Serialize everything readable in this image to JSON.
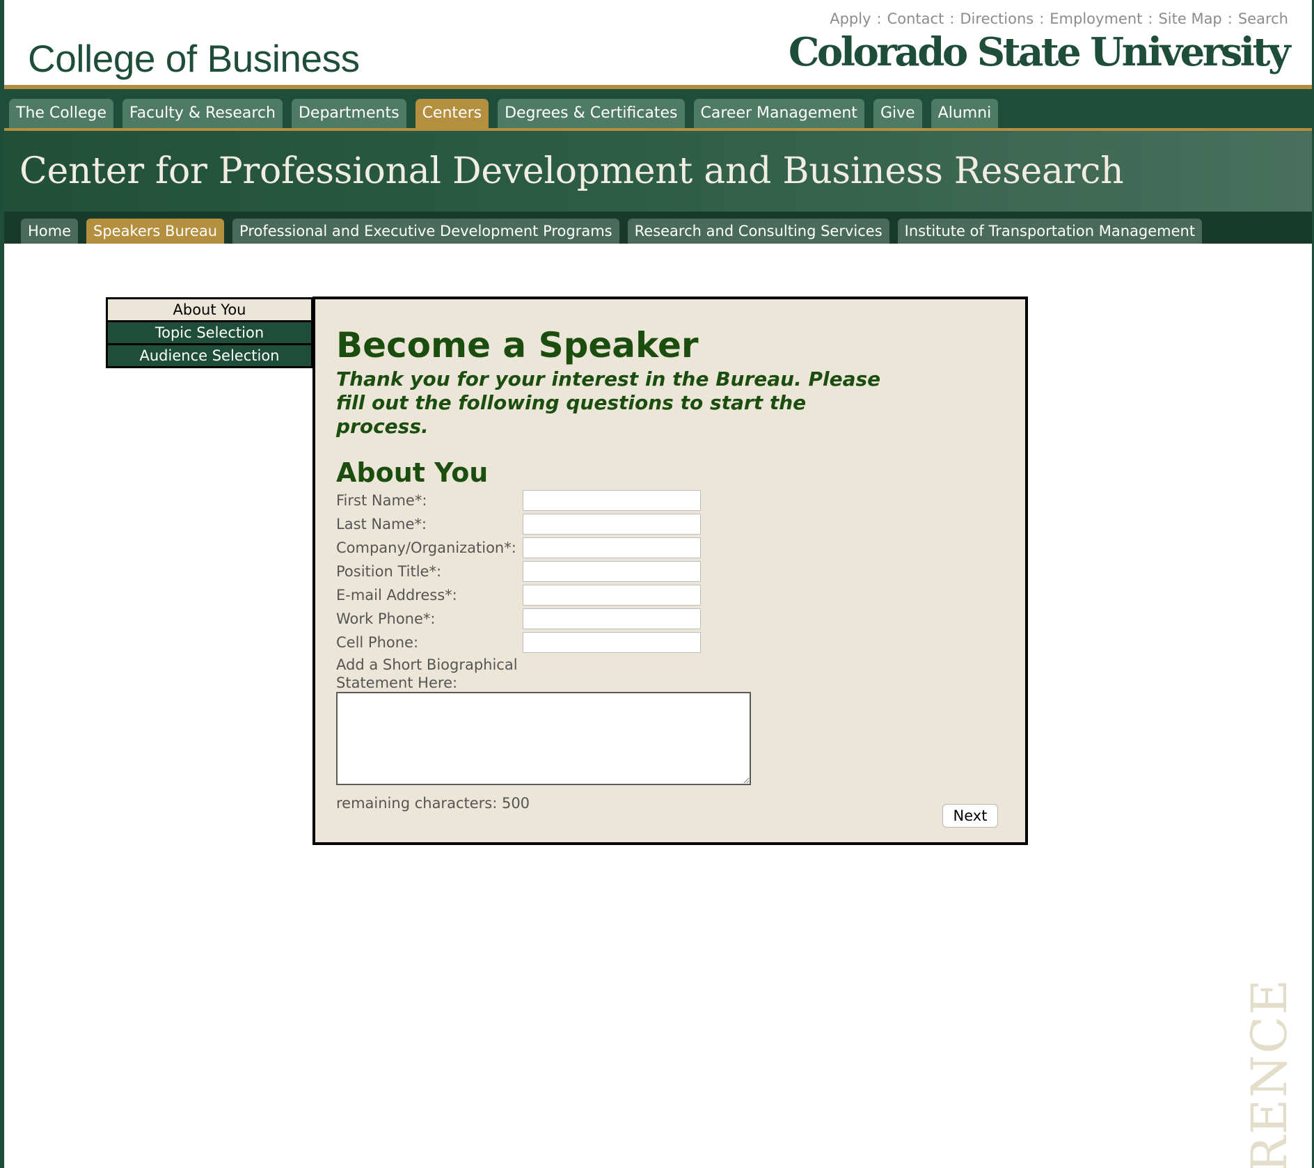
{
  "header": {
    "college_title": "College of Business",
    "university_logo_text": "Colorado State University",
    "utility_links": [
      "Apply",
      "Contact",
      "Directions",
      "Employment",
      "Site Map",
      "Search"
    ],
    "utility_separator": ":"
  },
  "main_nav": {
    "items": [
      "The College",
      "Faculty & Research",
      "Departments",
      "Centers",
      "Degrees & Certificates",
      "Career Management",
      "Give",
      "Alumni"
    ],
    "active": "Centers"
  },
  "banner": {
    "title": "Center for Professional Development and Business Research"
  },
  "sub_nav": {
    "items": [
      "Home",
      "Speakers Bureau",
      "Professional and Executive Development Programs",
      "Research and Consulting Services",
      "Institute of Transportation Management"
    ],
    "active": "Speakers Bureau"
  },
  "steps": {
    "items": [
      "About You",
      "Topic Selection",
      "Audience Selection"
    ],
    "current": "About You"
  },
  "form": {
    "title": "Become a Speaker",
    "subtitle": "Thank you for your interest in the Bureau. Please fill out the following questions to start the process.",
    "section_title": "About You",
    "fields": [
      {
        "label": "First Name*:",
        "value": ""
      },
      {
        "label": "Last Name*:",
        "value": ""
      },
      {
        "label": "Company/Organization*:",
        "value": ""
      },
      {
        "label": "Position Title*:",
        "value": ""
      },
      {
        "label": "E-mail Address*:",
        "value": ""
      },
      {
        "label": "Work Phone*:",
        "value": ""
      },
      {
        "label": "Cell Phone:",
        "value": ""
      }
    ],
    "bio_label": "Add a Short Biographical Statement Here:",
    "bio_value": "",
    "remaining_label": "remaining characters: 500",
    "next_label": "Next"
  },
  "watermark_text": "ERENCE",
  "colors": {
    "csu_green": "#1e4d3a",
    "csu_gold": "#b38f3f",
    "form_background": "#ece6d8",
    "heading_green": "#1b4d0f"
  }
}
